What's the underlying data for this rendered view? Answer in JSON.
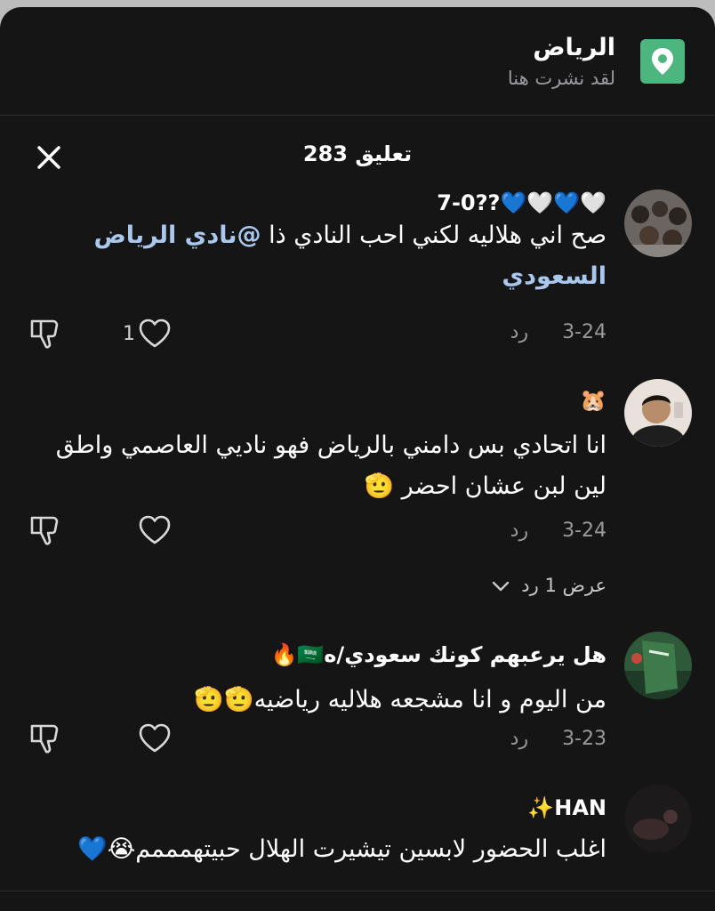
{
  "location": {
    "title": "الرياض",
    "subtitle": "لقد نشرت هنا"
  },
  "header": {
    "title": "283 تعليق"
  },
  "comments": [
    {
      "username": "🤍💙🤍💙??7-0",
      "text": "صح اني هلاليه لكني احب النادي ذا ",
      "mention": "@نادي الرياض السعودي",
      "date": "3-24",
      "reply_label": "رد",
      "likes": "1"
    },
    {
      "username": "🐹",
      "text": "انا اتحادي بس دامني بالرياض فهو ناديي العاصمي واطق لين لبن عشان احضر 🫡",
      "date": "3-24",
      "reply_label": "رد",
      "likes": "",
      "view_replies": "عرض 1 رد"
    },
    {
      "username": "هل يرعبهم كونك سعودي/ه🇸🇦🔥",
      "text": "من اليوم و انا مشجعه هلاليه رياضيه🫡🫡",
      "date": "3-23",
      "reply_label": "رد",
      "likes": ""
    },
    {
      "username": "HAN✨",
      "text": "اغلب الحضور لابسين تيشيرت الهلال حبيتهمممم😭💙"
    }
  ],
  "colors": {
    "panel": "#151516",
    "accent_mention": "#aac7ee",
    "pin": "#4db57e"
  }
}
